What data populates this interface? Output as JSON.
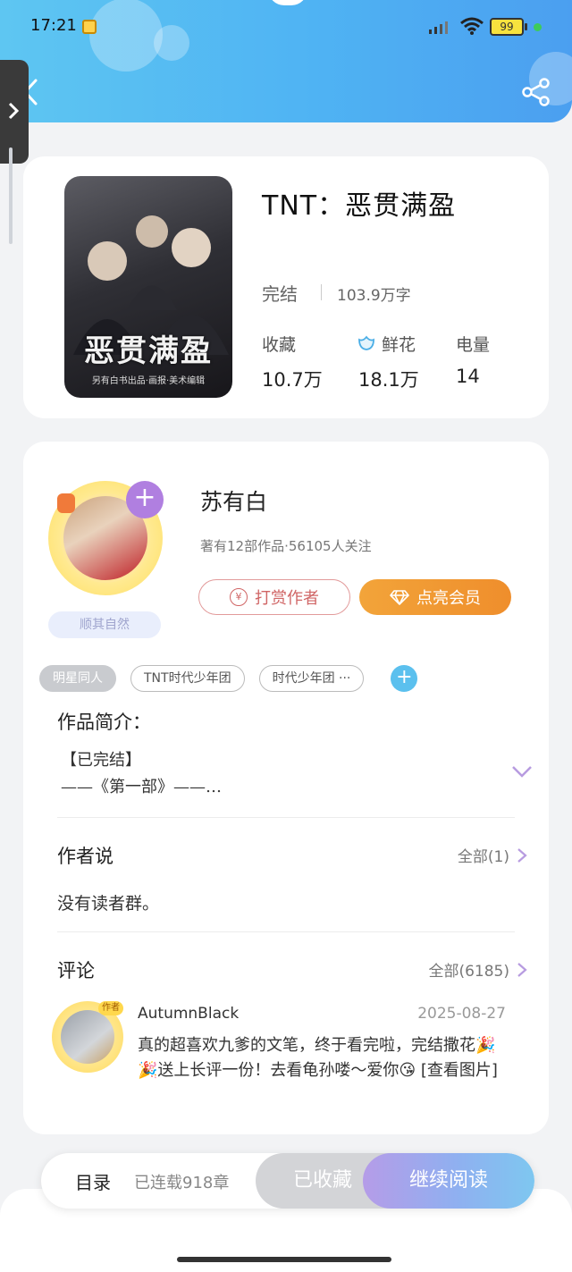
{
  "status_bar": {
    "time": "17:21",
    "battery": "99",
    "wifi_sub": "6"
  },
  "header": {
    "background_color": "#4fb3f3",
    "icons": [
      "chevron-left-icon",
      "share-icon"
    ]
  },
  "book": {
    "cover_title": "恶贯满盈",
    "cover_subtitle": "另有白书出品·画报·美术编辑",
    "title": "TNT：恶贯满盈",
    "status": "完结",
    "word_count": "103.9万字",
    "stats": [
      {
        "label": "收藏",
        "value": "10.7万"
      },
      {
        "label": "鲜花",
        "value": "18.1万"
      },
      {
        "label": "电量",
        "value": "14"
      }
    ]
  },
  "author": {
    "name": "苏有白",
    "meta": "著有12部作品·56105人关注",
    "badge": "顺其自然",
    "reward_label": "打赏作者",
    "vip_label": "点亮会员",
    "reward_icon_text": "¥"
  },
  "tags": [
    "明星同人",
    "TNT时代少年团",
    "时代少年团 ···"
  ],
  "intro": {
    "title": "作品简介：",
    "text": "【已完结】\n——《第一部》——…"
  },
  "author_says": {
    "title": "作者说",
    "more": "全部(1)",
    "text": "没有读者群。"
  },
  "comments": {
    "title": "评论",
    "more": "全部(6185)",
    "items": [
      {
        "user": "AutumnBlack",
        "badge": "作者",
        "date": "2025-08-27",
        "text": "真的超喜欢九爹的文笔，终于看完啦，完结撒花🎉🎉送上长评一份！去看龟孙喽～爱你😘 [查看图片]"
      }
    ]
  },
  "bottom_bar": {
    "toc_label": "目录",
    "chapter_count": "已连载918章",
    "saved_label": "已收藏",
    "read_label": "继续阅读"
  },
  "colors": {
    "vip_orange": "#ef8e2c",
    "reward_red": "#d06565",
    "follow_purple": "#b07fe0",
    "tag_add_blue": "#5bc0ee"
  }
}
